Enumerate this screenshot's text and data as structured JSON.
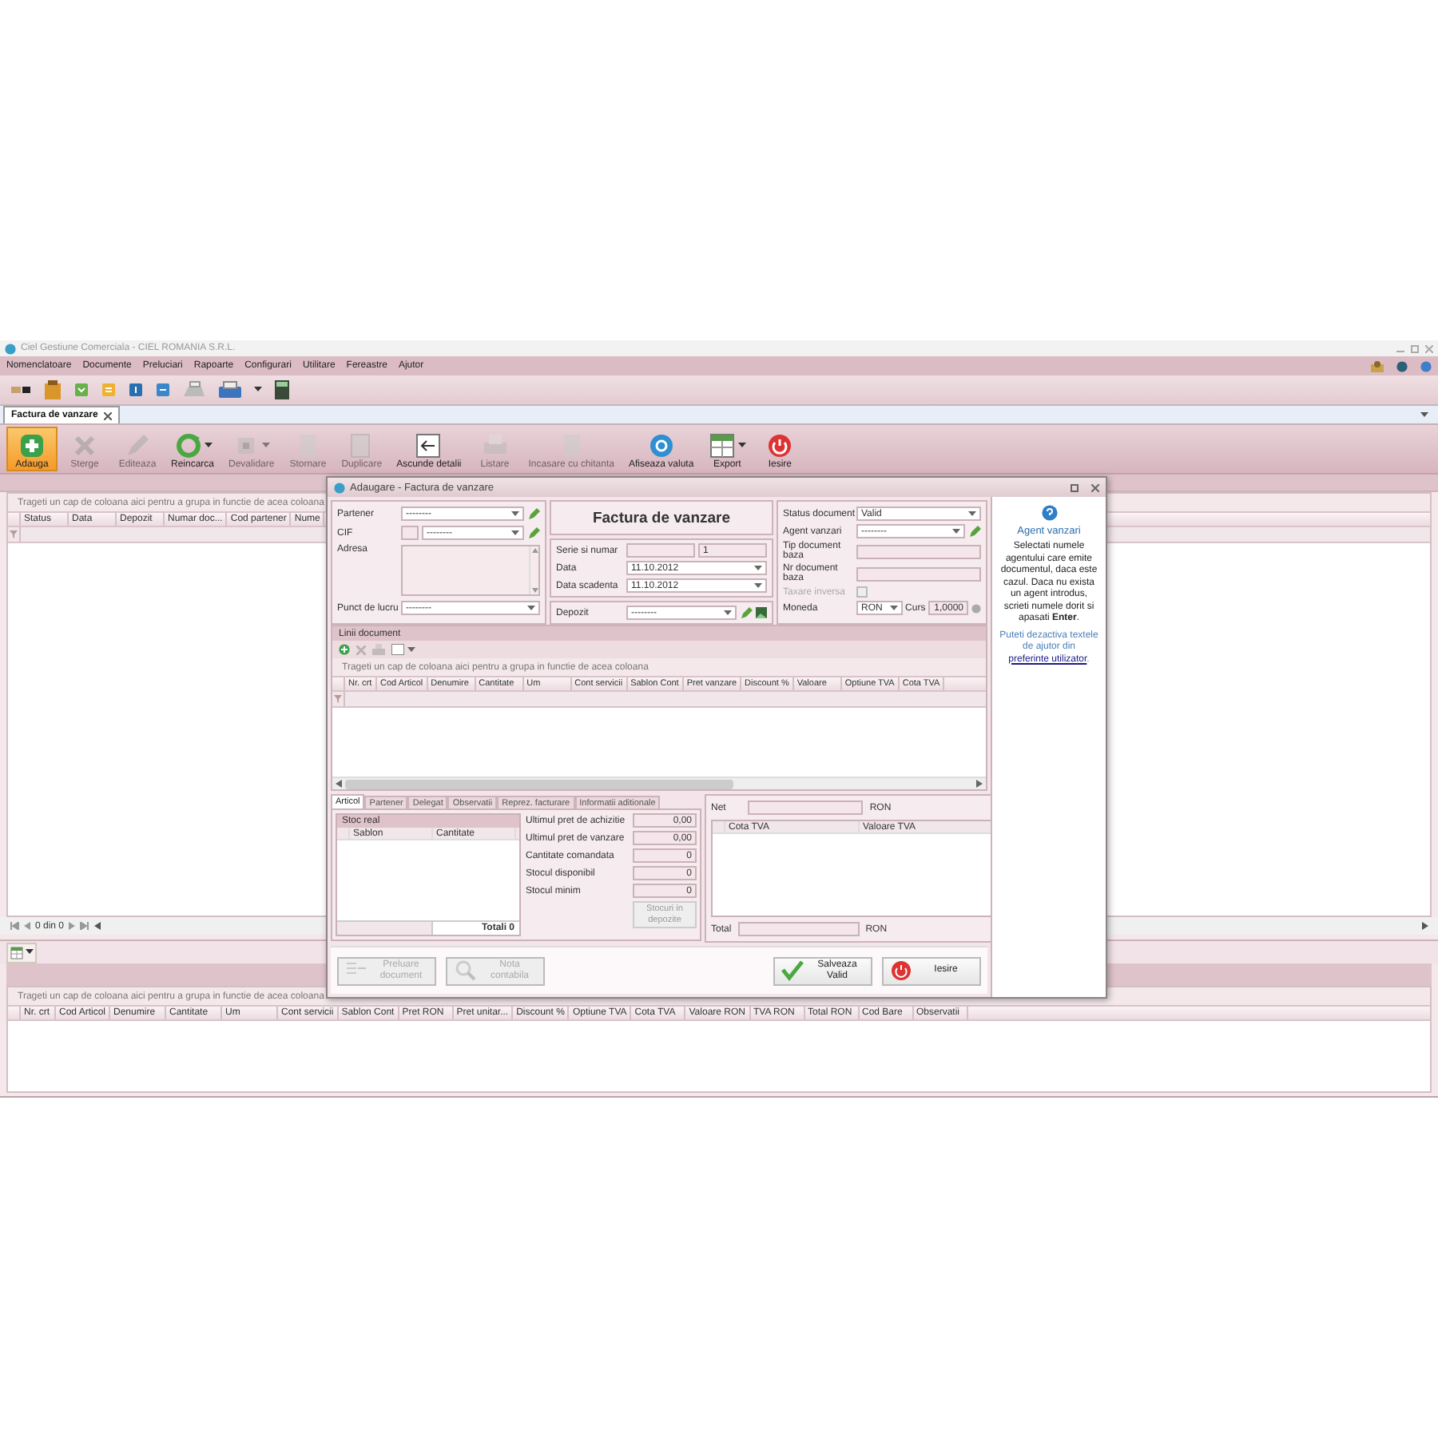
{
  "window": {
    "title": "Ciel Gestiune Comerciala - CIEL ROMANIA S.R.L."
  },
  "menu": [
    "Nomenclatoare",
    "Documente",
    "Preluciari",
    "Rapoarte",
    "Configurari",
    "Utilitare",
    "Fereastre",
    "Ajutor"
  ],
  "document_tabs": [
    {
      "label": "Factura de vanzare",
      "selected": true
    }
  ],
  "ribbon": [
    {
      "label": "Adauga",
      "selected": true,
      "disabled": false,
      "has_menu": false
    },
    {
      "label": "Sterge",
      "selected": false,
      "disabled": true,
      "has_menu": false
    },
    {
      "label": "Editeaza",
      "selected": false,
      "disabled": true,
      "has_menu": false
    },
    {
      "label": "Reincarca",
      "selected": false,
      "disabled": false,
      "has_menu": true
    },
    {
      "label": "Devalidare",
      "selected": false,
      "disabled": true,
      "has_menu": true
    },
    {
      "label": "Stornare",
      "selected": false,
      "disabled": true,
      "has_menu": false
    },
    {
      "label": "Duplicare",
      "selected": false,
      "disabled": true,
      "has_menu": false
    },
    {
      "label": "Ascunde detalii",
      "selected": false,
      "disabled": false,
      "has_menu": false
    },
    {
      "label": "Listare",
      "selected": false,
      "disabled": true,
      "has_menu": false
    },
    {
      "label": "Incasare cu chitanta",
      "selected": false,
      "disabled": true,
      "has_menu": false
    },
    {
      "label": "Afiseaza valuta",
      "selected": false,
      "disabled": false,
      "has_menu": false
    },
    {
      "label": "Export",
      "selected": false,
      "disabled": false,
      "has_menu": true
    },
    {
      "label": "Iesire",
      "selected": false,
      "disabled": false,
      "has_menu": false
    }
  ],
  "main_grid": {
    "group_hint": "Trageti un cap de coloana aici pentru a grupa in functie de acea coloana",
    "columns": [
      "Status",
      "Data",
      "Depozit",
      "Numar doc...",
      "Cod partener",
      "Nume"
    ]
  },
  "pager": {
    "text": "0 din 0"
  },
  "invoice_dialog": {
    "title": "Adaugare - Factura de vanzare",
    "partner": {
      "partener": {
        "label": "Partener",
        "value": "--------"
      },
      "cif": {
        "label": "CIF",
        "value": "--------"
      },
      "adresa": {
        "label": "Adresa"
      },
      "punct_de_lucru": {
        "label": "Punct de lucru",
        "value": "--------"
      }
    },
    "document": {
      "heading": "Factura de vanzare",
      "serie_si_numar": {
        "label": "Serie si numar",
        "number": "1"
      },
      "data": {
        "label": "Data",
        "value": "11.10.2012"
      },
      "data_scadenta": {
        "label": "Data scadenta",
        "value": "11.10.2012"
      },
      "depozit": {
        "label": "Depozit",
        "value": "--------"
      }
    },
    "status": {
      "status_document": {
        "label": "Status document",
        "value": "Valid"
      },
      "agent_vanzari": {
        "label": "Agent vanzari",
        "value": "--------"
      },
      "tip_document_baza": {
        "label": "Tip document baza"
      },
      "nr_document_baza": {
        "label": "Nr document baza"
      },
      "taxare_inversa": {
        "label": "Taxare inversa",
        "checked": false,
        "disabled": true
      },
      "moneda": {
        "label": "Moneda",
        "value": "RON"
      },
      "curs": {
        "label": "Curs",
        "value": "1,0000"
      }
    },
    "lines": {
      "title": "Linii document",
      "group_hint": "Trageti un cap de coloana aici pentru a grupa in functie de acea coloana",
      "columns": [
        "Nr. crt",
        "Cod Articol",
        "Denumire",
        "Cantitate",
        "Um",
        "Cont servicii",
        "Sablon Cont",
        "Pret vanzare",
        "Discount %",
        "Valoare",
        "Optiune TVA",
        "Cota TVA"
      ]
    },
    "detail_tabs": [
      {
        "label": "Articol",
        "selected": true
      },
      {
        "label": "Partener",
        "selected": false
      },
      {
        "label": "Delegat",
        "selected": false
      },
      {
        "label": "Observatii",
        "selected": false
      },
      {
        "label": "Reprez. facturare",
        "selected": false
      },
      {
        "label": "Informatii aditionale",
        "selected": false
      }
    ],
    "stock": {
      "title": "Stoc real",
      "columns": [
        "Sablon",
        "Cantitate"
      ],
      "total": "Totali 0"
    },
    "article_info": [
      {
        "label": "Ultimul pret de achizitie",
        "value": "0,00"
      },
      {
        "label": "Ultimul pret de vanzare",
        "value": "0,00"
      },
      {
        "label": "Cantitate comandata",
        "value": "0"
      },
      {
        "label": "Stocul disponibil",
        "value": "0"
      },
      {
        "label": "Stocul minim",
        "value": "0"
      }
    ],
    "stock_button": {
      "label": "Stocuri in depozite",
      "disabled": true
    },
    "totals": {
      "net_label": "Net",
      "net_currency": "RON",
      "columns": [
        "Cota TVA",
        "Valoare TVA"
      ],
      "total_label": "Total",
      "total_currency": "RON"
    },
    "buttons": [
      {
        "label": "Preluare document",
        "disabled": true
      },
      {
        "label": "Nota contabila",
        "disabled": true
      },
      {
        "label": "Salveaza Valid",
        "disabled": false
      },
      {
        "label": "Iesire",
        "disabled": false
      }
    ],
    "help": {
      "title": "Agent vanzari",
      "text": "Selectati numele agentului care emite documentul, daca este cazul. Daca nu exista un agent introdus, scrieti numele dorit si apasati **Enter**.",
      "hint": "Puteti dezactiva textele de ajutor din",
      "link": "preferinte utilizator",
      "hint_end": "."
    }
  },
  "bottom_grid": {
    "group_hint": "Trageti un cap de coloana aici pentru a grupa in functie de acea coloana",
    "columns": [
      "Nr. crt",
      "Cod Articol",
      "Denumire",
      "Cantitate",
      "Um",
      "Cont servicii",
      "Sablon Cont",
      "Pret RON",
      "Pret unitar...",
      "Discount %",
      "Optiune TVA",
      "Cota TVA",
      "Valoare RON",
      "TVA RON",
      "Total RON",
      "Cod Bare",
      "Observatii"
    ]
  }
}
